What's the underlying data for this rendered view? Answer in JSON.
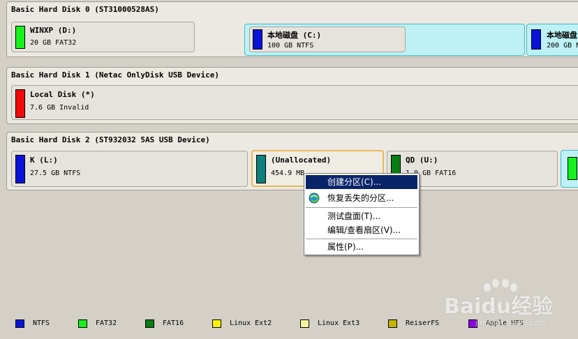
{
  "colors": {
    "ntfs": "#0a14d8",
    "fat32": "#16f21e",
    "fat16": "#0a7d14",
    "ext2": "#f8f400",
    "ext3": "#f8f49a",
    "reiserfs": "#c2b600",
    "hfs": "#8b00e6",
    "invalid": "#f20a0a",
    "unallocated": "#0e807e"
  },
  "disks": [
    {
      "title": "Basic Hard Disk 0 (ST31000528AS)",
      "partitions": [
        {
          "name": "WINXP (D:)",
          "info": "20 GB FAT32",
          "color": "fat32"
        },
        {
          "name": "本地磁盘 (C:)",
          "info": "100 GB NTFS",
          "color": "ntfs"
        },
        {
          "name": "本地磁盘",
          "info": "200 GB N",
          "color": "ntfs"
        }
      ]
    },
    {
      "title": "Basic Hard Disk 1 (Netac OnlyDisk USB Device)",
      "partitions": [
        {
          "name": "Local Disk (*)",
          "info": "7.6 GB Invalid",
          "color": "invalid"
        }
      ]
    },
    {
      "title": "Basic Hard Disk 2 (ST932032 5AS USB Device)",
      "partitions": [
        {
          "name": "K (L:)",
          "info": "27.5 GB NTFS",
          "color": "ntfs"
        },
        {
          "name": "(Unallocated)",
          "info": "454.9 MB",
          "color": "unallocated"
        },
        {
          "name": "QD (U:)",
          "info": "1.9 GB FAT16",
          "color": "fat16"
        }
      ]
    }
  ],
  "context_menu": {
    "items": [
      {
        "label": "创建分区(C)...",
        "highlighted": true
      },
      {
        "label": "恢复丢失的分区...",
        "icon": "recover-icon"
      },
      {
        "label": "测试盘面(T)..."
      },
      {
        "label": "编辑/查看扇区(V)..."
      },
      {
        "label": "属性(P)..."
      }
    ]
  },
  "legend": [
    {
      "label": "NTFS",
      "color": "ntfs"
    },
    {
      "label": "FAT32",
      "color": "fat32"
    },
    {
      "label": "FAT16",
      "color": "fat16"
    },
    {
      "label": "Linux Ext2",
      "color": "ext2"
    },
    {
      "label": "Linux Ext3",
      "color": "ext3"
    },
    {
      "label": "ReiserFS",
      "color": "reiserfs"
    },
    {
      "label": "Apple HFS",
      "color": "hfs"
    }
  ],
  "watermark": {
    "text": "Baidu经验",
    "sub": "jingyan.baidu.com"
  }
}
